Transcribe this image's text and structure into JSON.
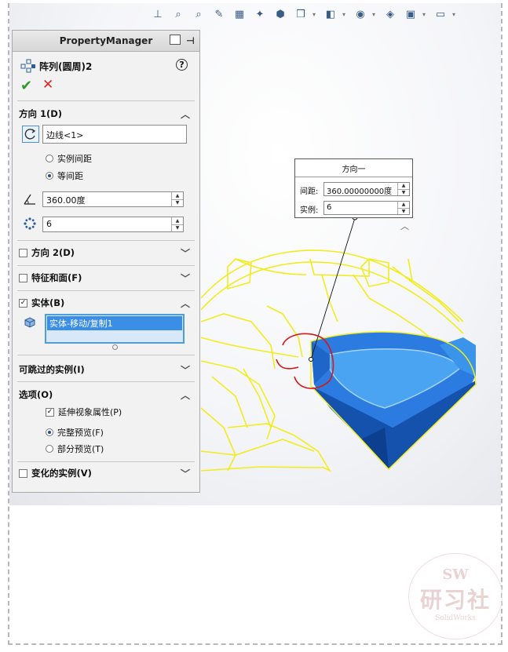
{
  "panel": {
    "header": "PropertyManager",
    "feature_title": "阵列(圆周)2",
    "help": "?",
    "ok": "✔",
    "cancel": "✕"
  },
  "direction1": {
    "label": "方向 1(D)",
    "edge_value": "边线<1>",
    "option_instance_spacing": "实例间距",
    "option_equal_spacing": "等间距",
    "selected_option": "等间距",
    "angle": "360.00度",
    "count": "6"
  },
  "direction2": {
    "label": "方向 2(D)",
    "checked": false
  },
  "features_faces": {
    "label": "特征和面(F)",
    "checked": false
  },
  "bodies": {
    "label": "实体(B)",
    "checked": true,
    "list": [
      "实体-移动/复制1"
    ]
  },
  "skip_instances": {
    "label": "可跳过的实例(I)"
  },
  "options": {
    "label": "选项(O)",
    "propagate": {
      "label": "延伸视象属性(P)",
      "checked": true
    },
    "full_preview": "完整预览(F)",
    "partial_preview": "部分预览(T)",
    "selected_preview": "完整预览(F)"
  },
  "varying_instances": {
    "label": "变化的实例(V)",
    "checked": false
  },
  "callout": {
    "title": "方向一",
    "spacing_label": "间距:",
    "spacing_value": "360.00000000度",
    "instances_label": "实例:",
    "instances_value": "6"
  },
  "watermark": {
    "top": "SW",
    "middle": "研习社",
    "bottom": "SolidWorks"
  },
  "colors": {
    "wireframe": "#f2ec1f",
    "body_blue": "#1f5fc4",
    "annotation_red": "#d41818",
    "accept_green": "#2e9a2e"
  }
}
